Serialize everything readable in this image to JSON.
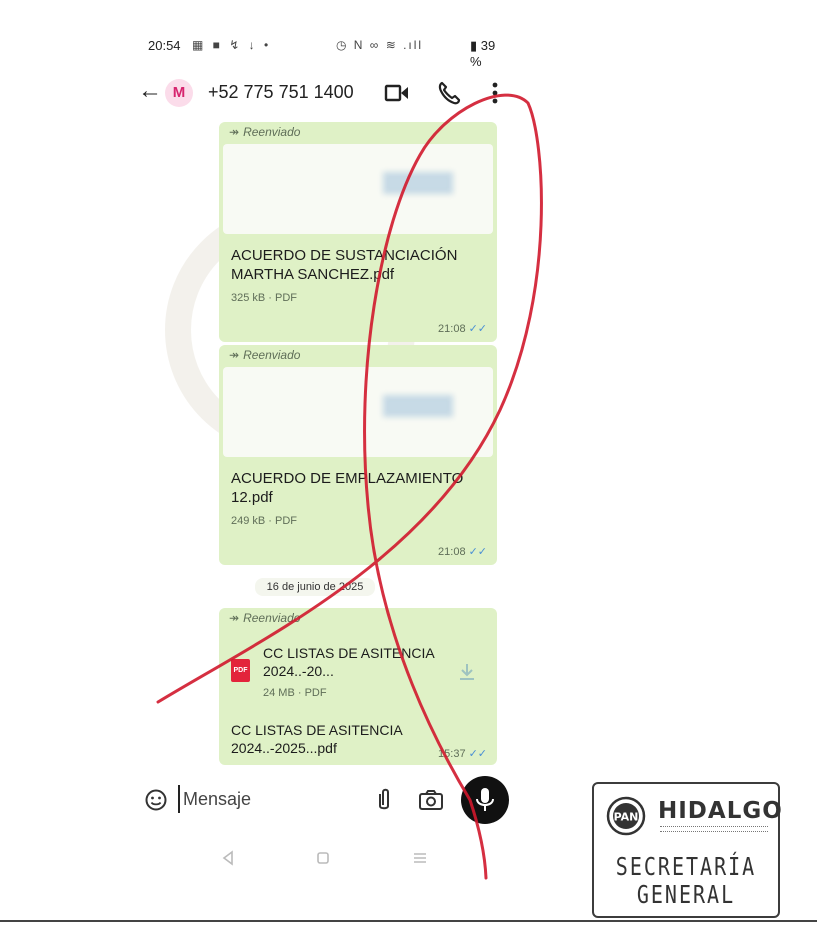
{
  "status_bar": {
    "time": "20:54",
    "left_icons": "▦ ■ ↯ ↓ •",
    "right_icons": "◷ N ∞ ≋ .ıll",
    "battery": "▮ 39 %"
  },
  "header": {
    "avatar_letter": "M",
    "contact": "+52 775 751 1400",
    "icons": [
      "video-call-icon",
      "phone-icon",
      "more-vert-icon"
    ]
  },
  "messages": [
    {
      "forwarded_label": "Reenviado",
      "file_name": "ACUERDO DE SUSTANCIACIÓN MARTHA SANCHEZ.pdf",
      "file_meta": "325 kB · PDF",
      "time": "21:08",
      "ticks": "✓✓"
    },
    {
      "forwarded_label": "Reenviado",
      "file_name": "ACUERDO DE EMPLAZAMIENTO 12.pdf",
      "file_meta": "249 kB · PDF",
      "time": "21:08",
      "ticks": "✓✓"
    }
  ],
  "date_separator": "16 de junio de 2025",
  "attachment_message": {
    "forwarded_label": "Reenviado",
    "badge": "PDF",
    "title": "CC LISTAS DE ASITENCIA 2024..-20...",
    "meta": "24 MB · PDF",
    "caption": "CC LISTAS DE ASITENCIA 2024..-2025...pdf",
    "time": "15:37",
    "ticks": "✓✓"
  },
  "input": {
    "placeholder": "Mensaje"
  },
  "stamp": {
    "state": "HIDALGO",
    "seal_text": "PAN",
    "office_line1": "SECRETARÍA",
    "office_line2": "GENERAL"
  },
  "colors": {
    "bubble": "#dff1c6",
    "avatar_bg": "#fbdcea",
    "avatar_fg": "#d6246e",
    "pdf_badge": "#e3243b",
    "ticks": "#4a8fd4",
    "ink_mark": "#d0182c"
  }
}
